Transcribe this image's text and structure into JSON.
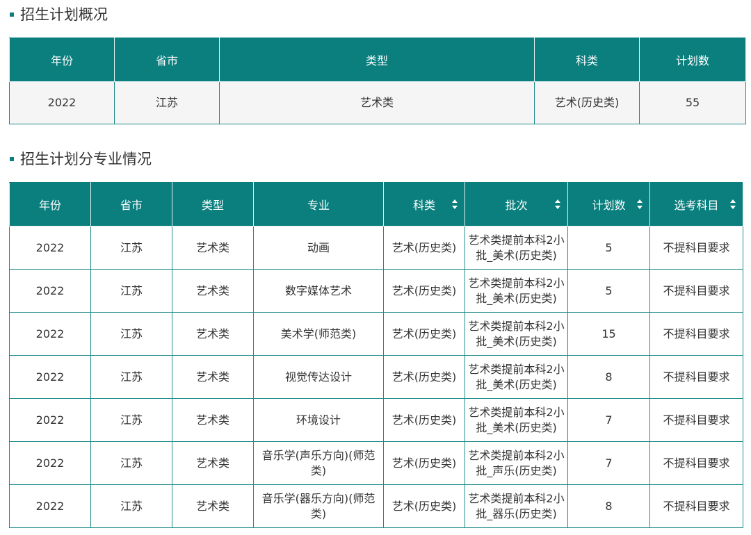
{
  "overview": {
    "title": "招生计划概况",
    "headers": [
      "年份",
      "省市",
      "类型",
      "科类",
      "计划数"
    ],
    "row": [
      "2022",
      "江苏",
      "艺术类",
      "艺术(历史类)",
      "55"
    ]
  },
  "detail": {
    "title": "招生计划分专业情况",
    "headers": [
      "年份",
      "省市",
      "类型",
      "专业",
      "科类",
      "批次",
      "计划数",
      "选考科目"
    ],
    "rows": [
      [
        "2022",
        "江苏",
        "艺术类",
        "动画",
        "艺术(历史类)",
        "艺术类提前本科2小批_美术(历史类)",
        "5",
        "不提科目要求"
      ],
      [
        "2022",
        "江苏",
        "艺术类",
        "数字媒体艺术",
        "艺术(历史类)",
        "艺术类提前本科2小批_美术(历史类)",
        "5",
        "不提科目要求"
      ],
      [
        "2022",
        "江苏",
        "艺术类",
        "美术学(师范类)",
        "艺术(历史类)",
        "艺术类提前本科2小批_美术(历史类)",
        "15",
        "不提科目要求"
      ],
      [
        "2022",
        "江苏",
        "艺术类",
        "视觉传达设计",
        "艺术(历史类)",
        "艺术类提前本科2小批_美术(历史类)",
        "8",
        "不提科目要求"
      ],
      [
        "2022",
        "江苏",
        "艺术类",
        "环境设计",
        "艺术(历史类)",
        "艺术类提前本科2小批_美术(历史类)",
        "7",
        "不提科目要求"
      ],
      [
        "2022",
        "江苏",
        "艺术类",
        "音乐学(声乐方向)(师范类)",
        "艺术(历史类)",
        "艺术类提前本科2小批_声乐(历史类)",
        "7",
        "不提科目要求"
      ],
      [
        "2022",
        "江苏",
        "艺术类",
        "音乐学(器乐方向)(师范类)",
        "艺术(历史类)",
        "艺术类提前本科2小批_器乐(历史类)",
        "8",
        "不提科目要求"
      ]
    ]
  },
  "colors": {
    "header_bg": "#0a7f7e",
    "border": "#1f8a89",
    "summary_row_bg": "#f5f5f5"
  },
  "icons": {
    "sort": "sort-updown-icon",
    "marker": "square-bullet-icon"
  }
}
